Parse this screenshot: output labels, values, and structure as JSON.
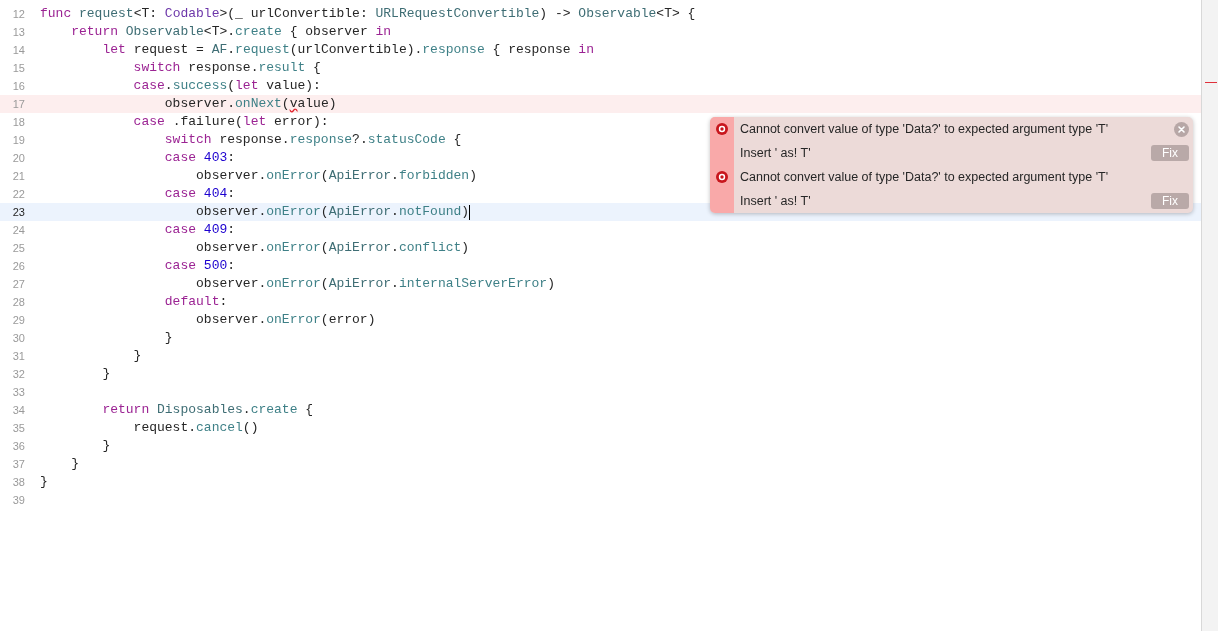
{
  "editor": {
    "lines": [
      {
        "number": "12",
        "segments": [
          {
            "kind": "keyword",
            "text": "func"
          },
          {
            "kind": "type",
            "text": " request"
          },
          {
            "kind": "plain",
            "text": "<T: "
          },
          {
            "kind": "builtin",
            "text": "Codable"
          },
          {
            "kind": "plain",
            "text": ">(_ urlConvertible: "
          },
          {
            "kind": "type",
            "text": "URLRequestConvertible"
          },
          {
            "kind": "plain",
            "text": ") -> "
          },
          {
            "kind": "type",
            "text": "Observable"
          },
          {
            "kind": "plain",
            "text": "<T> {"
          }
        ]
      },
      {
        "number": "13",
        "segments": [
          {
            "kind": "keyword",
            "text": "    return"
          },
          {
            "kind": "type",
            "text": " Observable"
          },
          {
            "kind": "plain",
            "text": "<T>."
          },
          {
            "kind": "member",
            "text": "create"
          },
          {
            "kind": "plain",
            "text": " { observer "
          },
          {
            "kind": "keyword",
            "text": "in"
          }
        ]
      },
      {
        "number": "14",
        "segments": [
          {
            "kind": "keyword",
            "text": "        let"
          },
          {
            "kind": "plain",
            "text": " request = "
          },
          {
            "kind": "type",
            "text": "AF"
          },
          {
            "kind": "plain",
            "text": "."
          },
          {
            "kind": "member",
            "text": "request"
          },
          {
            "kind": "plain",
            "text": "(urlConvertible)."
          },
          {
            "kind": "member",
            "text": "response"
          },
          {
            "kind": "plain",
            "text": " { response "
          },
          {
            "kind": "keyword",
            "text": "in"
          }
        ]
      },
      {
        "number": "15",
        "segments": [
          {
            "kind": "keyword",
            "text": "            switch"
          },
          {
            "kind": "plain",
            "text": " response."
          },
          {
            "kind": "member",
            "text": "result"
          },
          {
            "kind": "plain",
            "text": " {"
          }
        ]
      },
      {
        "number": "16",
        "segments": [
          {
            "kind": "keyword",
            "text": "            case"
          },
          {
            "kind": "plain",
            "text": "."
          },
          {
            "kind": "member",
            "text": "success"
          },
          {
            "kind": "plain",
            "text": "("
          },
          {
            "kind": "keyword",
            "text": "let"
          },
          {
            "kind": "plain",
            "text": " value):"
          }
        ]
      },
      {
        "number": "17",
        "error": true,
        "segments": [
          {
            "kind": "plain",
            "text": "                observer."
          },
          {
            "kind": "member",
            "text": "onNext"
          },
          {
            "kind": "plain",
            "text": "("
          },
          {
            "kind": "error",
            "text": "v"
          },
          {
            "kind": "plain",
            "text": "alue)"
          }
        ]
      },
      {
        "number": "18",
        "segments": [
          {
            "kind": "keyword",
            "text": "            case"
          },
          {
            "kind": "plain",
            "text": " .failure("
          },
          {
            "kind": "keyword",
            "text": "let"
          },
          {
            "kind": "plain",
            "text": " error):"
          }
        ]
      },
      {
        "number": "19",
        "segments": [
          {
            "kind": "keyword",
            "text": "                switch"
          },
          {
            "kind": "plain",
            "text": " response."
          },
          {
            "kind": "member",
            "text": "response"
          },
          {
            "kind": "plain",
            "text": "?."
          },
          {
            "kind": "member",
            "text": "statusCode"
          },
          {
            "kind": "plain",
            "text": " {"
          }
        ]
      },
      {
        "number": "20",
        "segments": [
          {
            "kind": "keyword",
            "text": "                case"
          },
          {
            "kind": "number",
            "text": " 403"
          },
          {
            "kind": "plain",
            "text": ":"
          }
        ]
      },
      {
        "number": "21",
        "segments": [
          {
            "kind": "plain",
            "text": "                    observer."
          },
          {
            "kind": "member",
            "text": "onError"
          },
          {
            "kind": "plain",
            "text": "("
          },
          {
            "kind": "type",
            "text": "ApiError"
          },
          {
            "kind": "plain",
            "text": "."
          },
          {
            "kind": "member",
            "text": "forbidden"
          },
          {
            "kind": "plain",
            "text": ")"
          }
        ]
      },
      {
        "number": "22",
        "segments": [
          {
            "kind": "keyword",
            "text": "                case"
          },
          {
            "kind": "number",
            "text": " 404"
          },
          {
            "kind": "plain",
            "text": ":"
          }
        ]
      },
      {
        "number": "23",
        "current": true,
        "cursor": true,
        "segments": [
          {
            "kind": "plain",
            "text": "                    observer."
          },
          {
            "kind": "member",
            "text": "onError"
          },
          {
            "kind": "plain",
            "text": "("
          },
          {
            "kind": "type",
            "text": "ApiError"
          },
          {
            "kind": "plain",
            "text": "."
          },
          {
            "kind": "member",
            "text": "notFound"
          },
          {
            "kind": "plain",
            "text": ")"
          }
        ]
      },
      {
        "number": "24",
        "segments": [
          {
            "kind": "keyword",
            "text": "                case"
          },
          {
            "kind": "number",
            "text": " 409"
          },
          {
            "kind": "plain",
            "text": ":"
          }
        ]
      },
      {
        "number": "25",
        "segments": [
          {
            "kind": "plain",
            "text": "                    observer."
          },
          {
            "kind": "member",
            "text": "onError"
          },
          {
            "kind": "plain",
            "text": "("
          },
          {
            "kind": "type",
            "text": "ApiError"
          },
          {
            "kind": "plain",
            "text": "."
          },
          {
            "kind": "member",
            "text": "conflict"
          },
          {
            "kind": "plain",
            "text": ")"
          }
        ]
      },
      {
        "number": "26",
        "segments": [
          {
            "kind": "keyword",
            "text": "                case"
          },
          {
            "kind": "number",
            "text": " 500"
          },
          {
            "kind": "plain",
            "text": ":"
          }
        ]
      },
      {
        "number": "27",
        "segments": [
          {
            "kind": "plain",
            "text": "                    observer."
          },
          {
            "kind": "member",
            "text": "onError"
          },
          {
            "kind": "plain",
            "text": "("
          },
          {
            "kind": "type",
            "text": "ApiError"
          },
          {
            "kind": "plain",
            "text": "."
          },
          {
            "kind": "member",
            "text": "internalServerError"
          },
          {
            "kind": "plain",
            "text": ")"
          }
        ]
      },
      {
        "number": "28",
        "segments": [
          {
            "kind": "keyword",
            "text": "                default"
          },
          {
            "kind": "plain",
            "text": ":"
          }
        ]
      },
      {
        "number": "29",
        "segments": [
          {
            "kind": "plain",
            "text": "                    observer."
          },
          {
            "kind": "member",
            "text": "onError"
          },
          {
            "kind": "plain",
            "text": "(error)"
          }
        ]
      },
      {
        "number": "30",
        "segments": [
          {
            "kind": "plain",
            "text": "                }"
          }
        ]
      },
      {
        "number": "31",
        "segments": [
          {
            "kind": "plain",
            "text": "            }"
          }
        ]
      },
      {
        "number": "32",
        "segments": [
          {
            "kind": "plain",
            "text": "        }"
          }
        ]
      },
      {
        "number": "33"
      },
      {
        "number": "34",
        "segments": [
          {
            "kind": "keyword",
            "text": "        return"
          },
          {
            "kind": "type",
            "text": " Disposables"
          },
          {
            "kind": "plain",
            "text": "."
          },
          {
            "kind": "member",
            "text": "create"
          },
          {
            "kind": "plain",
            "text": " {"
          }
        ]
      },
      {
        "number": "35",
        "segments": [
          {
            "kind": "plain",
            "text": "            request."
          },
          {
            "kind": "member",
            "text": "cancel"
          },
          {
            "kind": "plain",
            "text": "()"
          }
        ]
      },
      {
        "number": "36",
        "segments": [
          {
            "kind": "plain",
            "text": "        }"
          }
        ]
      },
      {
        "number": "37",
        "segments": [
          {
            "kind": "plain",
            "text": "    }"
          }
        ]
      },
      {
        "number": "38",
        "segments": [
          {
            "kind": "plain",
            "text": "}"
          }
        ]
      },
      {
        "number": "39"
      }
    ]
  },
  "issues_popup": {
    "close_button": true,
    "issues": [
      {
        "message": "Cannot convert value of type 'Data?' to expected argument type 'T'",
        "fix_description": "Insert ' as! T'",
        "fix_button": "Fix"
      },
      {
        "message": "Cannot convert value of type 'Data?' to expected argument type 'T'",
        "fix_description": "Insert ' as! T'",
        "fix_button": "Fix"
      }
    ]
  }
}
